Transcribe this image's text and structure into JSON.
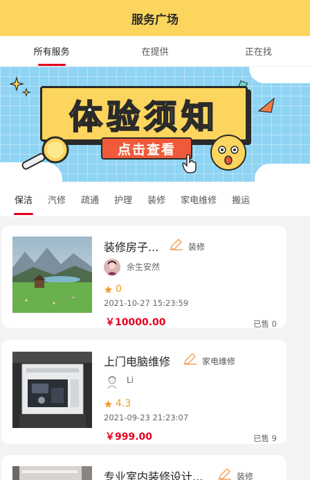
{
  "header": {
    "title": "服务广场"
  },
  "tabs": [
    {
      "label": "所有服务"
    },
    {
      "label": "在提供"
    },
    {
      "label": "正在找"
    }
  ],
  "banner": {
    "headline": "体验须知",
    "button": "点击查看"
  },
  "categories": [
    "保洁",
    "汽修",
    "疏通",
    "护理",
    "装修",
    "家电维修",
    "搬运"
  ],
  "services": [
    {
      "title": "装修房子...",
      "type": "装修",
      "user": "余生安然",
      "rating": "0",
      "date": "2021-10-27 15:23:59",
      "price": "￥10000.00",
      "sold": "已售 0"
    },
    {
      "title": "上门电脑维修",
      "type": "家电维修",
      "user": "Li",
      "rating": "4.3",
      "date": "2021-09-23 21:23:07",
      "price": "￥999.00",
      "sold": "已售 9"
    },
    {
      "title": "专业室内装修设计...",
      "type": "装修"
    }
  ],
  "colors": {
    "accent": "#e4001e",
    "header_bg": "#fcd55e",
    "star": "#f59a23"
  }
}
